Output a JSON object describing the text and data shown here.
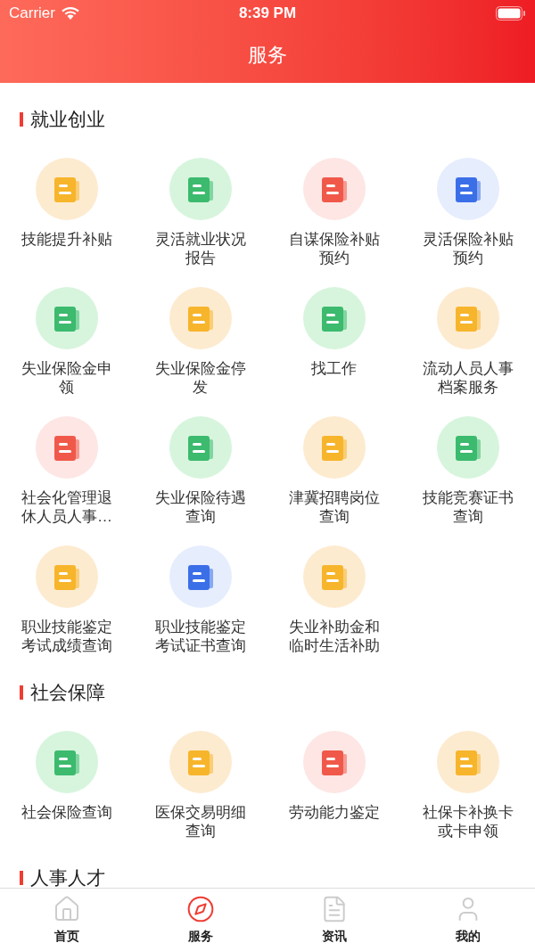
{
  "status_bar": {
    "carrier": "Carrier",
    "time": "8:39 PM"
  },
  "nav": {
    "title": "服务"
  },
  "sections": [
    {
      "title": "就业创业",
      "items": [
        {
          "label": "技能提升补贴",
          "color": "#fdebd0"
        },
        {
          "label": "灵活就业状况报告",
          "color": "#d7f5dd"
        },
        {
          "label": "自谋保险补贴预约",
          "color": "#fde6e4"
        },
        {
          "label": "灵活保险补贴预约",
          "color": "#e6edfd"
        },
        {
          "label": "失业保险金申领",
          "color": "#d7f5dd"
        },
        {
          "label": "失业保险金停发",
          "color": "#fdebd0"
        },
        {
          "label": "找工作",
          "color": "#d7f5dd"
        },
        {
          "label": "流动人员人事档案服务",
          "color": "#fdebd0"
        },
        {
          "label": "社会化管理退休人员人事…",
          "color": "#fde6e4"
        },
        {
          "label": "失业保险待遇查询",
          "color": "#d7f5dd"
        },
        {
          "label": "津冀招聘岗位查询",
          "color": "#fdebd0"
        },
        {
          "label": "技能竞赛证书查询",
          "color": "#d7f5dd"
        },
        {
          "label": "职业技能鉴定考试成绩查询",
          "color": "#fdebd0"
        },
        {
          "label": "职业技能鉴定考试证书查询",
          "color": "#e6edfd"
        },
        {
          "label": "失业补助金和临时生活补助",
          "color": "#fdebd0"
        }
      ]
    },
    {
      "title": "社会保障",
      "items": [
        {
          "label": "社会保险查询",
          "color": "#d7f5dd"
        },
        {
          "label": "医保交易明细查询",
          "color": "#fdebd0"
        },
        {
          "label": "劳动能力鉴定",
          "color": "#fde6e4"
        },
        {
          "label": "社保卡补换卡或卡申领",
          "color": "#fdebd0"
        }
      ]
    },
    {
      "title": "人事人才"
    }
  ],
  "tab_bar": [
    {
      "label": "首页",
      "kind": "home",
      "selected": false
    },
    {
      "label": "服务",
      "kind": "compass",
      "selected": true
    },
    {
      "label": "资讯",
      "kind": "news",
      "selected": false
    },
    {
      "label": "我的",
      "kind": "user",
      "selected": false
    }
  ]
}
